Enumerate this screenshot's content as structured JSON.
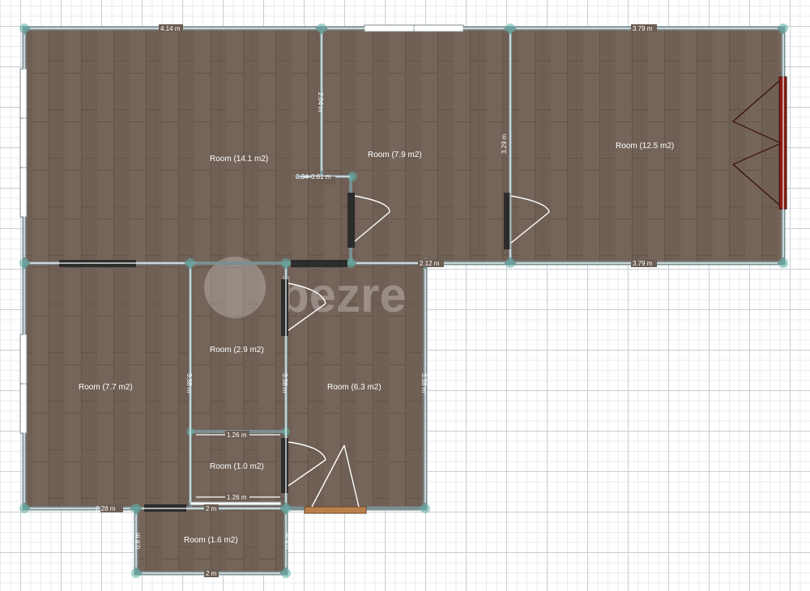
{
  "rooms": [
    {
      "id": "room-14-1",
      "label": "Room (14.1 m2)"
    },
    {
      "id": "room-7-9",
      "label": "Room (7.9 m2)"
    },
    {
      "id": "room-12-5",
      "label": "Room (12.5 m2)"
    },
    {
      "id": "room-7-7",
      "label": "Room (7.7 m2)"
    },
    {
      "id": "room-2-9",
      "label": "Room (2.9 m2)"
    },
    {
      "id": "room-6-3",
      "label": "Room (6.3 m2)"
    },
    {
      "id": "room-1-0",
      "label": "Room (1.0 m2)"
    },
    {
      "id": "room-1-6",
      "label": "Room (1.6 m2)"
    }
  ],
  "dimensions": {
    "top_left_width": "4.14 m",
    "top_right_width": "3.79 m",
    "bottom_right_width": "3.79 m",
    "mid_width": "2.12 m",
    "stub_height": "2.04 m",
    "closet_width": "0.81 m",
    "closet_small": "0.34",
    "room79_height": "3.29 m",
    "hall_height_left": "3.38 m",
    "hall_height_mid": "3.38 m",
    "hall_height_right": "3.38 m",
    "small_width_1": "1.26 m",
    "small_width_2": "1.26 m",
    "bottom_left_width": "2.28 m",
    "bottom_mid_width": "2 m",
    "balcony_width": "2 m",
    "balcony_height_left": "0.8 m",
    "balcony_height_right": "0.8 m"
  },
  "watermark": {
    "text": "bezre"
  }
}
